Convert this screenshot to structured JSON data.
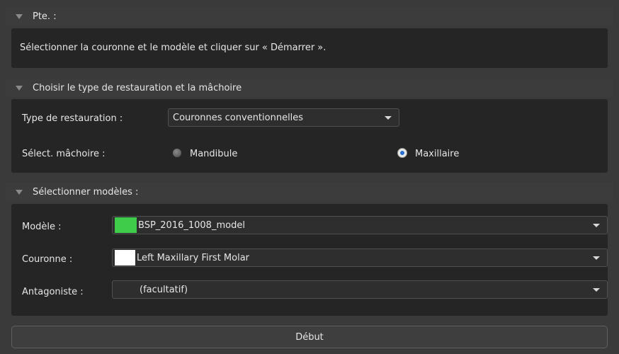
{
  "sections": {
    "patient": {
      "title": "Pte. :"
    },
    "restoration": {
      "title": "Choisir le type de restauration et la mâchoire"
    },
    "models": {
      "title": "Sélectionner modèles :"
    }
  },
  "instructions": "Sélectionner la couronne et le modèle et cliquer sur « Démarrer ».",
  "restoration": {
    "type_label": "Type de restauration :",
    "type_value": "Couronnes conventionnelles",
    "jaw_label": "Sélect. mâchoire :",
    "jaw_options": [
      "Mandibule",
      "Maxillaire"
    ],
    "jaw_selected": "Maxillaire"
  },
  "models": {
    "model_label": "Modèle :",
    "model_value": "BSP_2016_1008_model",
    "model_color": "#3fcc4a",
    "crown_label": "Couronne :",
    "crown_value": "Left Maxillary First Molar",
    "crown_color": "#ffffff",
    "antagonist_label": "Antagoniste :",
    "antagonist_value": "(facultatif)"
  },
  "start_button": "Début"
}
